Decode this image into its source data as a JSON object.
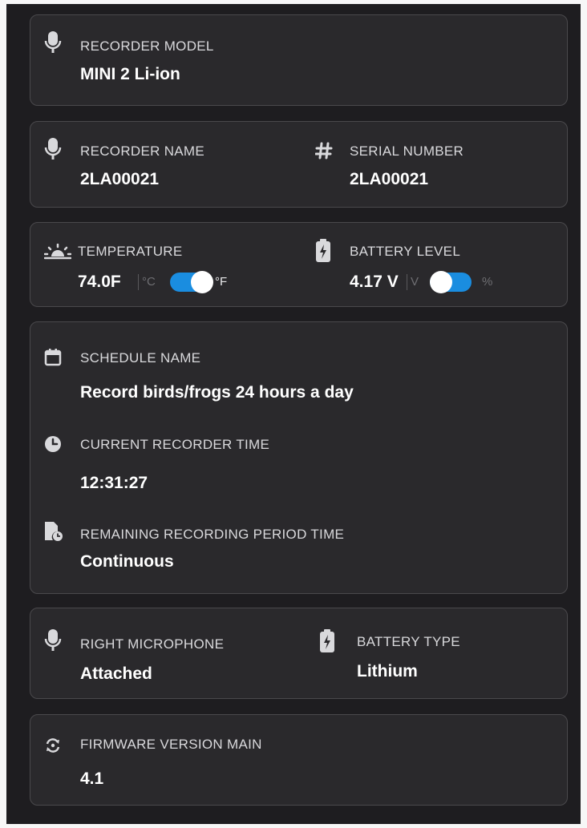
{
  "model": {
    "label": "RECORDER MODEL",
    "value": "MINI 2 Li-ion"
  },
  "name": {
    "label": "RECORDER NAME",
    "value": "2LA00021"
  },
  "serial": {
    "label": "SERIAL NUMBER",
    "value": "2LA00021"
  },
  "temperature": {
    "label": "TEMPERATURE",
    "value": "74.0F",
    "unit_left": "°C",
    "unit_right": "°F",
    "toggle_on": "°F"
  },
  "battery_level": {
    "label": "BATTERY LEVEL",
    "value": "4.17 V",
    "unit_left": "V",
    "unit_right": "%",
    "toggle_on": "V"
  },
  "schedule": {
    "label": "SCHEDULE NAME",
    "value": "Record birds/frogs 24 hours a day"
  },
  "recorder_time": {
    "label": "CURRENT RECORDER TIME",
    "value": "12:31:27"
  },
  "remaining": {
    "label": "REMAINING RECORDING PERIOD TIME",
    "value": "Continuous"
  },
  "right_mic": {
    "label": "RIGHT MICROPHONE",
    "value": "Attached"
  },
  "battery_type": {
    "label": "BATTERY TYPE",
    "value": "Lithium"
  },
  "firmware": {
    "label": "FIRMWARE VERSION MAIN",
    "value": "4.1"
  },
  "icons": {
    "microphone": "microphone-icon",
    "hash": "hash-icon",
    "sun": "sunrise-icon",
    "battery": "battery-icon",
    "calendar": "calendar-icon",
    "clock": "clock-icon",
    "file_time": "file-clock-icon",
    "sync": "sync-icon"
  },
  "colors": {
    "accent": "#1a8de0",
    "card": "#2a292c",
    "background": "#1e1d20"
  }
}
